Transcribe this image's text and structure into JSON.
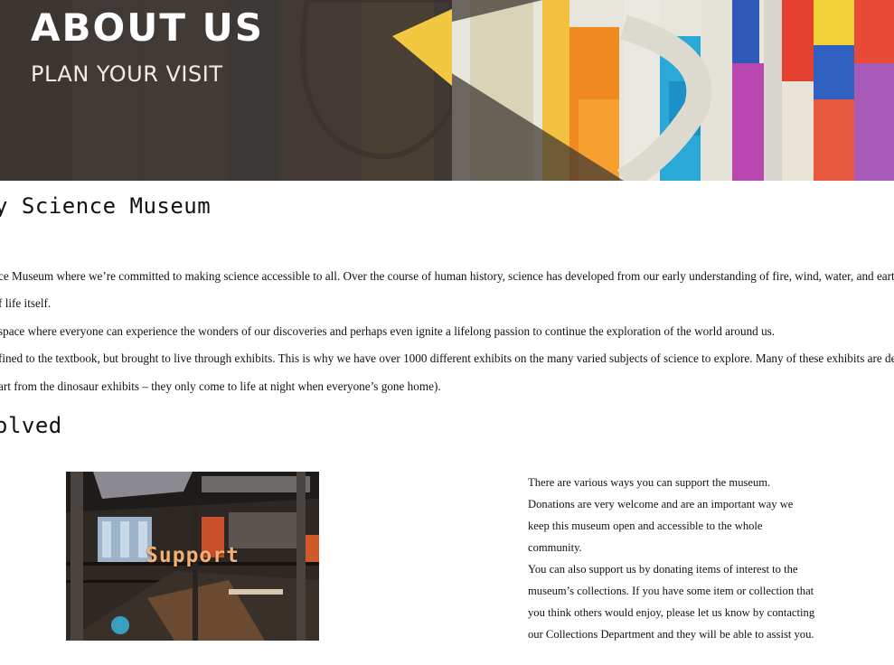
{
  "hero": {
    "title": "ABOUT US",
    "subtitle": "PLAN YOUR VISIT"
  },
  "welcome": {
    "heading": "y Science Museum",
    "paragraphs": [
      "ce Museum where we’re committed to making science accessible to all. Over the course of human history, science has developed from our early understanding of fire, wind, water, and earth to c",
      "f life itself.",
      "space where everyone can experience the wonders of our discoveries and perhaps even ignite a lifelong passion to continue the exploration of the world around us.",
      "fined to the textbook, but brought to live through exhibits. This is why we have over 1000 different exhibits on the many varied subjects of science to explore. Many of these exhibits are designe",
      "art from the dinosaur exhibits – they only come to life at night when everyone’s gone home)."
    ]
  },
  "involved": {
    "heading": "olved",
    "image_label": "Support",
    "lines": [
      "There are various ways you can support the museum.",
      "Donations are very welcome and are an important way we",
      "keep this museum open and accessible to the whole",
      "community.",
      "You can also support us by donating items of interest to the",
      "museum’s collections. If you have some item or collection that",
      "you think others would enjoy, please let us know by contacting",
      "our Collections Department and they will be able to assist you."
    ]
  },
  "colors": {
    "hero_overlay": "#3b3531",
    "support_label": "#f3b070",
    "text": "#111111"
  }
}
